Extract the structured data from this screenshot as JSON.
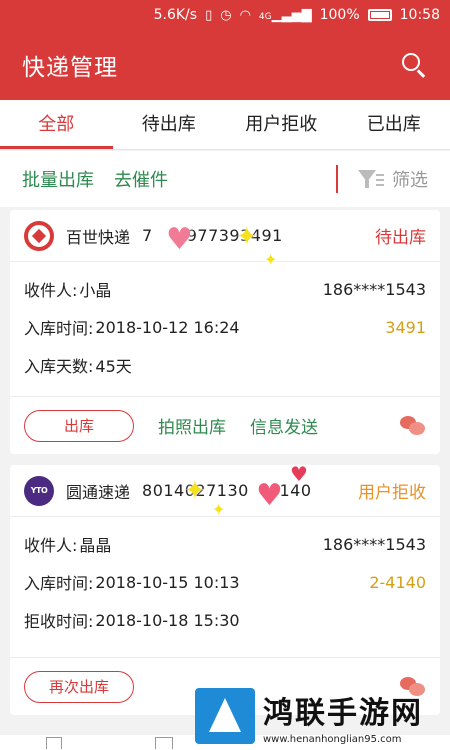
{
  "statusbar": {
    "network_speed": "5.6K/s",
    "signal_label": "4G",
    "battery": "100%",
    "time": "10:58"
  },
  "app": {
    "title": "快递管理"
  },
  "tabs": [
    {
      "label": "全部"
    },
    {
      "label": "待出库"
    },
    {
      "label": "用户拒收"
    },
    {
      "label": "已出库"
    }
  ],
  "actions": {
    "batch_out": "批量出库",
    "remind": "去催件",
    "filter": "筛选"
  },
  "cards": [
    {
      "company": "百世快递",
      "tracking": "7",
      "tracking_tail": "977393491",
      "status": "待出库",
      "recipient_label": "收件人:",
      "recipient": "小晶",
      "phone": "186****1543",
      "time_label": "入库时间:",
      "time": "2018-10-12 16:24",
      "code": "3491",
      "extra_label": "入库天数:",
      "extra": "45天",
      "button": "出库",
      "link1": "拍照出库",
      "link2": "信息发送"
    },
    {
      "company": "圆通速递",
      "logo_text": "YTO",
      "tracking": "8014027130",
      "tracking_tail": "4140",
      "status": "用户拒收",
      "recipient_label": "收件人:",
      "recipient": "晶晶",
      "phone": "186****1543",
      "time_label": "入库时间:",
      "time": "2018-10-15 10:13",
      "code": "2-4140",
      "extra_label": "拒收时间:",
      "extra": "2018-10-18 15:30",
      "button": "再次出库"
    }
  ],
  "watermark": {
    "title": "鸿联手游网",
    "url": "www.henanhonglian95.com"
  },
  "colors": {
    "primary": "#d83a3a",
    "action_green": "#2e8b4f",
    "code_gold": "#d4a017"
  }
}
